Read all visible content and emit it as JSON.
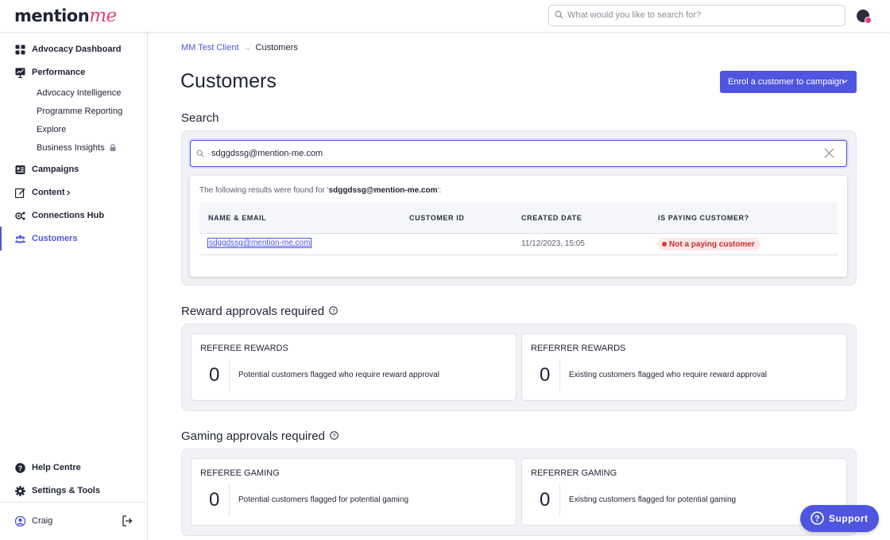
{
  "brand": {
    "logo_main": "mention",
    "logo_accent": "me"
  },
  "topbar": {
    "search_placeholder": "What would you like to search for?"
  },
  "sidebar": {
    "items": [
      {
        "label": "Advocacy Dashboard",
        "icon": "grid-icon"
      },
      {
        "label": "Performance",
        "icon": "chart-board-icon"
      },
      {
        "label": "Campaigns",
        "icon": "campaigns-icon"
      },
      {
        "label": "Content",
        "icon": "edit-icon"
      },
      {
        "label": "Connections Hub",
        "icon": "connections-icon"
      },
      {
        "label": "Customers",
        "icon": "users-icon"
      }
    ],
    "sub_items": [
      "Advocacy Intelligence",
      "Programme Reporting",
      "Explore",
      "Business Insights"
    ],
    "bottom": [
      {
        "label": "Help Centre",
        "icon": "help-icon"
      },
      {
        "label": "Settings & Tools",
        "icon": "gear-icon"
      }
    ],
    "user": {
      "name": "Craig"
    }
  },
  "breadcrumb": {
    "parent": "MM Test Client",
    "current": "Customers"
  },
  "page": {
    "title": "Customers",
    "enrol_button": "Enrol a customer to campaign"
  },
  "search": {
    "title": "Search",
    "value": "sdggdssg@mention-me.com",
    "found_prefix": "The following results were found for '",
    "found_term": "sdggdssg@mention-me.com",
    "found_suffix": "':",
    "columns": [
      "NAME & EMAIL",
      "CUSTOMER ID",
      "CREATED DATE",
      "IS PAYING CUSTOMER?"
    ],
    "rows": [
      {
        "email": "sdggdssg@mention-me.com",
        "customer_id": "",
        "created": "11/12/2023, 15:05",
        "paying": "Not a paying customer"
      }
    ]
  },
  "reward": {
    "title": "Reward approvals required",
    "cards": [
      {
        "title": "REFEREE REWARDS",
        "count": "0",
        "desc": "Potential customers flagged who require reward approval"
      },
      {
        "title": "REFERRER REWARDS",
        "count": "0",
        "desc": "Existing customers flagged who require reward approval"
      }
    ]
  },
  "gaming": {
    "title": "Gaming approvals required",
    "cards": [
      {
        "title": "REFEREE GAMING",
        "count": "0",
        "desc": "Potential customers flagged for potential gaming"
      },
      {
        "title": "REFERRER GAMING",
        "count": "0",
        "desc": "Existing customers flagged for potential gaming"
      }
    ]
  },
  "support": {
    "label": "Support"
  },
  "colors": {
    "accent": "#4f55e0",
    "brand_pink": "#e0407b",
    "danger": "#d93a3a"
  }
}
